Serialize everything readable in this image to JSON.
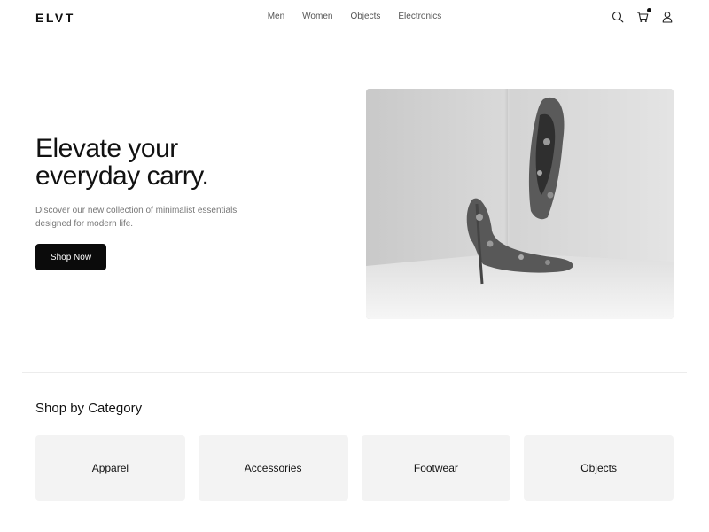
{
  "header": {
    "logo": "ELVT",
    "nav": [
      "Men",
      "Women",
      "Objects",
      "Electronics"
    ],
    "icons": [
      "search-icon",
      "cart-icon",
      "user-icon"
    ]
  },
  "hero": {
    "title_line1": "Elevate your",
    "title_line2": "everyday carry.",
    "subtitle": "Discover our new collection of minimalist essentials designed for modern life.",
    "button": "Shop Now"
  },
  "categories": {
    "title": "Shop by Category",
    "items": [
      "Apparel",
      "Accessories",
      "Footwear",
      "Objects"
    ]
  },
  "colors": {
    "primary": "#0b0b0b",
    "card_bg": "#f3f3f3",
    "divider": "#ececec"
  }
}
